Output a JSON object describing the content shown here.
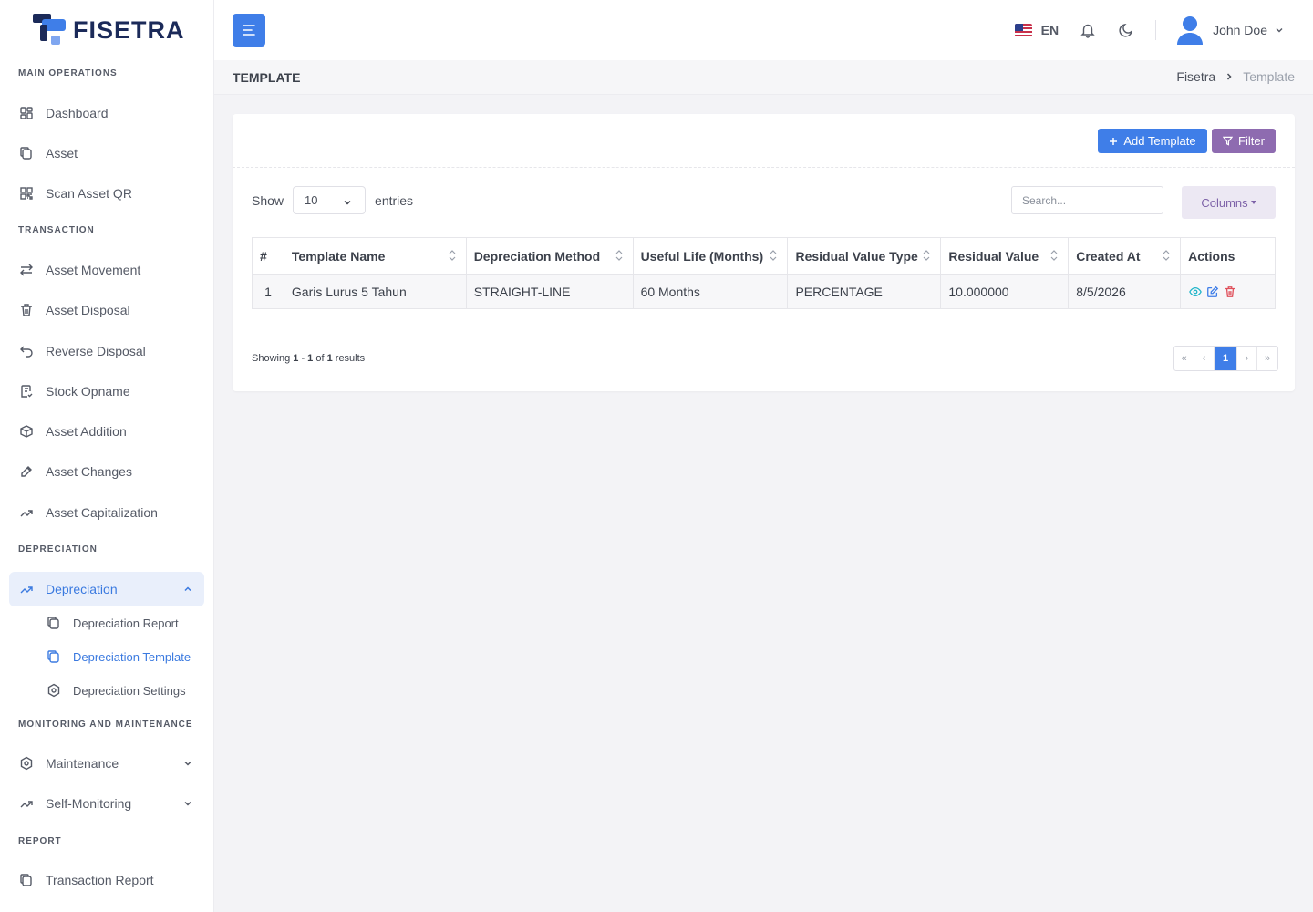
{
  "brand": {
    "name": "FISETRA"
  },
  "sidebar": {
    "sections": {
      "main": "MAIN OPERATIONS",
      "transaction": "TRANSACTION",
      "depreciation": "DEPRECIATION",
      "monitoring": "MONITORING AND MAINTENANCE",
      "report": "REPORT"
    },
    "items": {
      "dashboard": "Dashboard",
      "asset": "Asset",
      "scan": "Scan Asset QR",
      "movement": "Asset Movement",
      "disposal": "Asset Disposal",
      "reverse": "Reverse Disposal",
      "opname": "Stock Opname",
      "addition": "Asset Addition",
      "changes": "Asset Changes",
      "capitalization": "Asset Capitalization",
      "depreciation": "Depreciation",
      "dep_report": "Depreciation Report",
      "dep_template": "Depreciation Template",
      "dep_settings": "Depreciation Settings",
      "maintenance": "Maintenance",
      "self_monitoring": "Self-Monitoring",
      "transaction_report": "Transaction Report"
    }
  },
  "header": {
    "lang": "EN",
    "user_name": "John Doe"
  },
  "page": {
    "title": "TEMPLATE",
    "breadcrumb": {
      "home": "Fisetra",
      "current": "Template"
    }
  },
  "toolbar": {
    "add_label": "Add Template",
    "filter_label": "Filter",
    "columns_label": "Columns"
  },
  "listing": {
    "show_label": "Show",
    "entries_label": "entries",
    "page_size": "10",
    "search_placeholder": "Search..."
  },
  "table": {
    "headers": [
      "#",
      "Template Name",
      "Depreciation Method",
      "Useful Life (Months)",
      "Residual Value Type",
      "Residual Value",
      "Created At",
      "Actions"
    ],
    "rows": [
      [
        "1",
        "Garis Lurus 5 Tahun",
        "STRAIGHT-LINE",
        "60 Months",
        "PERCENTAGE",
        "10.000000",
        "8/5/2026"
      ]
    ]
  },
  "footer": {
    "showing_prefix": "Showing ",
    "from": "1",
    "dash": " - ",
    "to": "1",
    "of": " of ",
    "total": "1",
    "suffix": " results"
  },
  "pagination": {
    "first": "«",
    "prev": "‹",
    "current": "1",
    "next": "›",
    "last": "»"
  },
  "colors": {
    "primary": "#3f7ee8",
    "filter": "#8e6bb0",
    "brand_dark": "#1b2a59",
    "delete": "#e0505b",
    "view": "#22b5c9"
  }
}
